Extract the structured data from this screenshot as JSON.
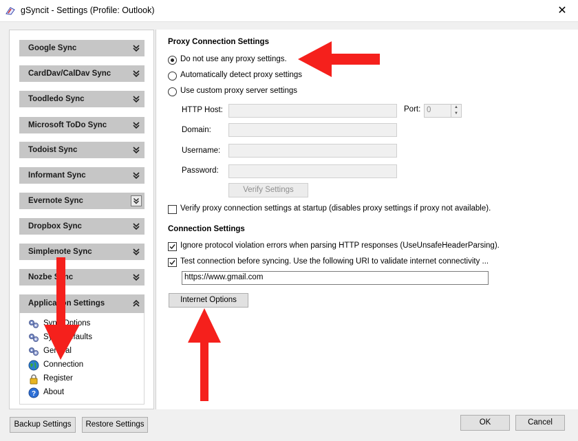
{
  "window": {
    "title": "gSyncit - Settings (Profile: Outlook)",
    "close_glyph": "✕"
  },
  "sidebar": {
    "groups": [
      {
        "label": "Google Sync"
      },
      {
        "label": "CardDav/CalDav Sync"
      },
      {
        "label": "Toodledo Sync"
      },
      {
        "label": "Microsoft ToDo Sync"
      },
      {
        "label": "Todoist Sync"
      },
      {
        "label": "Informant Sync"
      },
      {
        "label": "Evernote Sync"
      },
      {
        "label": "Dropbox Sync"
      },
      {
        "label": "Simplenote Sync"
      },
      {
        "label": "Nozbe Sync"
      },
      {
        "label": "Application Settings"
      }
    ],
    "app_items": [
      {
        "label": "Sync Options",
        "icon": "gears-icon"
      },
      {
        "label": "Sync Defaults",
        "icon": "gears-icon"
      },
      {
        "label": "General",
        "icon": "gears-icon"
      },
      {
        "label": "Connection",
        "icon": "globe-icon"
      },
      {
        "label": "Register",
        "icon": "lock-icon"
      },
      {
        "label": "About",
        "icon": "help-icon"
      }
    ]
  },
  "proxy": {
    "heading": "Proxy Connection Settings",
    "options": [
      {
        "label": "Do not use any proxy settings.",
        "selected": true
      },
      {
        "label": "Automatically detect proxy settings",
        "selected": false
      },
      {
        "label": "Use custom proxy server settings",
        "selected": false
      }
    ],
    "host_label": "HTTP Host:",
    "port_label": "Port:",
    "port_value": "0",
    "domain_label": "Domain:",
    "username_label": "Username:",
    "password_label": "Password:",
    "verify_button": "Verify Settings",
    "verify_startup_label": "Verify proxy connection settings at startup (disables proxy settings if proxy not available).",
    "verify_startup_checked": false
  },
  "connection": {
    "heading": "Connection Settings",
    "ignore_label": "Ignore protocol violation errors when parsing HTTP responses (UseUnsafeHeaderParsing).",
    "ignore_checked": true,
    "test_label": "Test connection before syncing. Use the following URI to validate internet connectivity ...",
    "test_checked": true,
    "uri_value": "https://www.gmail.com",
    "internet_options_button": "Internet Options"
  },
  "footer": {
    "backup_button": "Backup Settings",
    "restore_button": "Restore Settings",
    "ok_button": "OK",
    "cancel_button": "Cancel"
  },
  "colors": {
    "arrow": "#f5201c",
    "group_bg": "#c6c6c6"
  }
}
